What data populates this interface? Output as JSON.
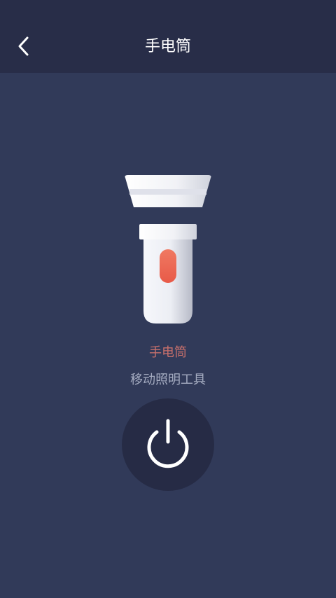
{
  "header": {
    "title": "手电筒"
  },
  "icons": {
    "back": "chevron-left-icon",
    "power": "power-icon",
    "flashlight": "flashlight-icon"
  },
  "main": {
    "title": "手电筒",
    "subtitle": "移动照明工具"
  },
  "colors": {
    "background": "#313a59",
    "header": "#282d48",
    "accent": "#c8706c",
    "button": "#262b45"
  }
}
